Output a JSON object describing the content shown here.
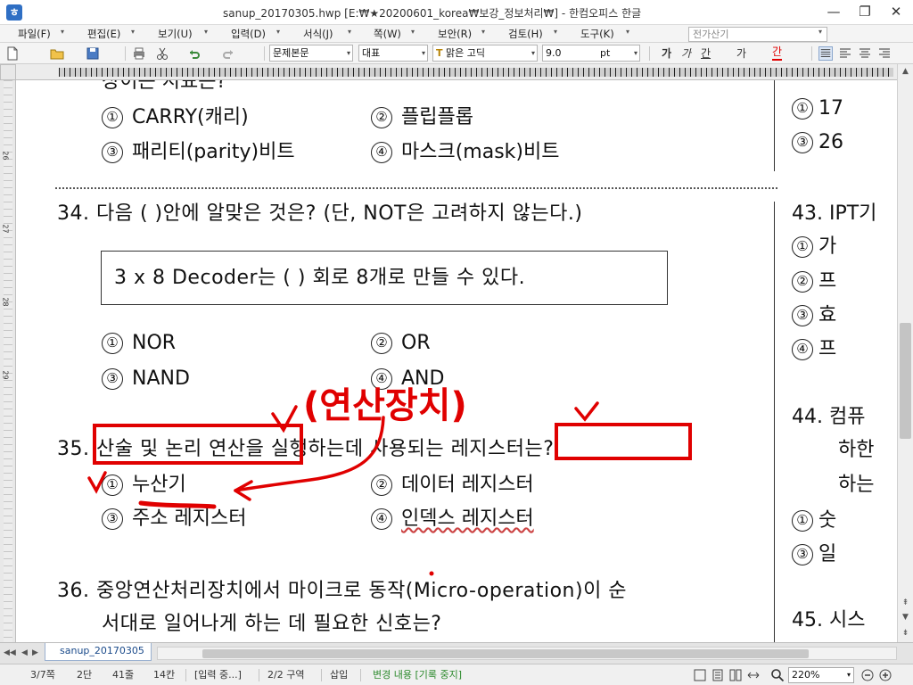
{
  "window": {
    "title": "sanup_20170305.hwp [E:₩★20200601_korea₩보강_정보처리₩] - 한컴오피스 한글",
    "app_icon_letter": "ㅎ",
    "minimize": "—",
    "restore": "❐",
    "close": "✕"
  },
  "menu": {
    "items": [
      "파일(F)",
      "편집(E)",
      "보기(U)",
      "입력(D)",
      "서식(J)",
      "쪽(W)",
      "보안(R)",
      "검토(H)",
      "도구(K)"
    ],
    "search_placeholder": "전가산기"
  },
  "toolbar": {
    "style_combo": "문제본문",
    "lang_combo": "대표",
    "font_combo": "맑은 고딕",
    "size_value": "9.0",
    "size_unit": "pt",
    "bold": "가",
    "italic": "가",
    "underline": "간",
    "strike": "가",
    "color": "간",
    "colors": {
      "accent_red": "#e00000",
      "link_blue": "#1a4a8a"
    }
  },
  "vruler": {
    "marks": [
      "26",
      "27",
      "28",
      "29"
    ]
  },
  "document": {
    "top_question_partial": "장이는 지표는?",
    "q33_options": [
      {
        "num": "①",
        "text": "CARRY(캐리)"
      },
      {
        "num": "②",
        "text": "플립플롭"
      },
      {
        "num": "③",
        "text": "패리티(parity)비트"
      },
      {
        "num": "④",
        "text": "마스크(mask)비트"
      }
    ],
    "q34": {
      "title": "34. 다음 ( )안에 알맞은 것은? (단, NOT은 고려하지 않는다.)",
      "box_text": "3 x 8 Decoder는 (    ) 회로 8개로 만들 수 있다.",
      "options": [
        {
          "num": "①",
          "text": "NOR"
        },
        {
          "num": "②",
          "text": "OR"
        },
        {
          "num": "③",
          "text": "NAND"
        },
        {
          "num": "④",
          "text": "AND"
        }
      ]
    },
    "q35": {
      "num": "35.",
      "p1": "산술 및 논리 연산",
      "p2": "을 실행하는데 사용되는",
      "p3": "레지스터는?",
      "options": [
        {
          "num": "①",
          "text": "누산기"
        },
        {
          "num": "②",
          "text": "데이터 레지스터"
        },
        {
          "num": "③",
          "text": "주소 레지스터"
        },
        {
          "num": "④",
          "text": "인덱스 레지스터"
        }
      ]
    },
    "q36": {
      "line1": "36. 중앙연산처리장치에서 마이크로 동작(Micro-operation)이 순",
      "line2": "서대로 일어나게 하는 데 필요한 신호는?"
    },
    "annotation_text": "(연산장치)",
    "right_column": {
      "top_opt1": {
        "num": "①",
        "text": "17"
      },
      "top_opt3": {
        "num": "③",
        "text": "26"
      },
      "q43_title": "43. IPT기",
      "q43_opts": [
        {
          "num": "①",
          "text": "가"
        },
        {
          "num": "②",
          "text": "프"
        },
        {
          "num": "③",
          "text": "효"
        },
        {
          "num": "④",
          "text": "프"
        }
      ],
      "q44_title": "44. 컴퓨",
      "q44_line2": "하한",
      "q44_line3": "하는",
      "q44_opts": [
        {
          "num": "①",
          "text": "숫"
        },
        {
          "num": "③",
          "text": "일"
        }
      ],
      "q45_title": "45. 시스"
    }
  },
  "tabs": {
    "doc_tab": "sanup_20170305"
  },
  "status": {
    "page": "3/7쪽",
    "column": "2단",
    "line": "41줄",
    "col_pos": "14칸",
    "input_mode": "[입력 중...]",
    "section": "2/2 구역",
    "insert": "삽입",
    "track": "변경 내용 [기록 중지]",
    "zoom": "220%"
  }
}
